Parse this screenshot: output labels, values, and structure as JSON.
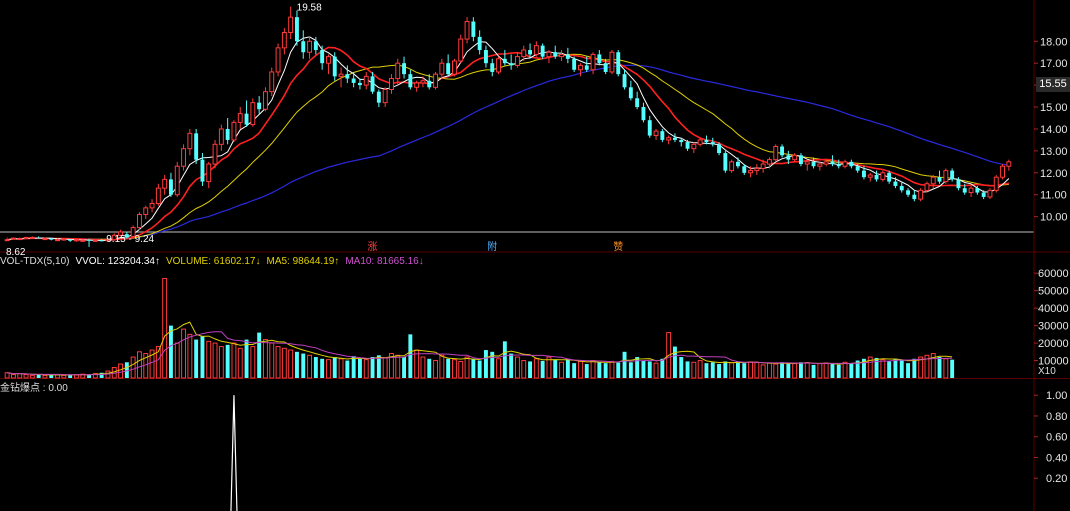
{
  "colors": {
    "up": "#ff3b3b",
    "down": "#54ffff",
    "ma_white": "#ffffff",
    "ma_red": "#ff2020",
    "ma_yellow": "#e0d000",
    "ma_blue": "#2a2ae0",
    "vol_ma5": "#e0d000",
    "vol_ma10": "#c040c0",
    "grid": "#5a0000",
    "signal": "#ffffff"
  },
  "price_panel": {
    "high_label": "19.58",
    "low_label": "8.62",
    "range_label": "9.15 - 9.24",
    "current_price": "15.55",
    "markers": [
      "涨",
      "附",
      "赞"
    ]
  },
  "volume_panel": {
    "header": {
      "indicator": "VOL-TDX(5,10)",
      "vvol": "VVOL: 123204.34↑",
      "volume": "VOLUME: 61602.17↓",
      "ma5": "MA5: 98644.19↑",
      "ma10": "MA10: 81665.16↓"
    },
    "unit_label": "X10"
  },
  "signal_panel": {
    "header": "金钻爆点 : 0.00"
  },
  "chart_data": [
    {
      "type": "candlestick",
      "title": "",
      "ylim": [
        9.3,
        19.7
      ],
      "y_ticks": [
        "18.00",
        "17.00",
        "16.00",
        "15.00",
        "14.00",
        "13.00",
        "12.00",
        "11.00",
        "10.00"
      ],
      "y_tick_values": [
        18,
        17,
        16,
        15,
        14,
        13,
        12,
        11,
        10
      ],
      "ohlc": [
        [
          8.95,
          9.05,
          9.0,
          8.95
        ],
        [
          9.0,
          9.05,
          8.98,
          9.02
        ],
        [
          9.0,
          9.05,
          8.95,
          9.0
        ],
        [
          9.0,
          9.08,
          8.97,
          9.05
        ],
        [
          9.05,
          9.1,
          9.0,
          9.05
        ],
        [
          9.05,
          9.1,
          9.0,
          9.02
        ],
        [
          9.0,
          9.05,
          8.95,
          9.0
        ],
        [
          9.0,
          9.05,
          8.92,
          8.95
        ],
        [
          8.95,
          9.0,
          8.9,
          8.95
        ],
        [
          8.95,
          9.02,
          8.9,
          8.98
        ],
        [
          8.95,
          9.0,
          8.85,
          8.9
        ],
        [
          8.9,
          8.98,
          8.85,
          8.95
        ],
        [
          8.9,
          8.97,
          8.85,
          8.92
        ],
        [
          8.95,
          9.0,
          8.62,
          8.9
        ],
        [
          8.9,
          8.95,
          8.85,
          8.92
        ],
        [
          8.92,
          8.98,
          8.87,
          8.9
        ],
        [
          8.9,
          9.0,
          8.85,
          8.95
        ],
        [
          8.95,
          9.24,
          8.9,
          9.15
        ],
        [
          9.15,
          9.4,
          9.1,
          9.3
        ],
        [
          9.2,
          9.3,
          9.0,
          9.05
        ],
        [
          9.1,
          9.6,
          9.05,
          9.5
        ],
        [
          9.5,
          10.2,
          9.4,
          10.1
        ],
        [
          10.1,
          10.5,
          9.9,
          10.4
        ],
        [
          10.4,
          10.8,
          10.2,
          10.6
        ],
        [
          10.6,
          11.5,
          10.5,
          11.3
        ],
        [
          11.3,
          11.9,
          11.0,
          11.7
        ],
        [
          11.7,
          12.0,
          10.9,
          11.0
        ],
        [
          11.0,
          12.5,
          10.9,
          12.3
        ],
        [
          12.3,
          13.3,
          12.1,
          13.1
        ],
        [
          13.1,
          14.0,
          12.8,
          13.8
        ],
        [
          13.8,
          14.0,
          12.4,
          12.6
        ],
        [
          12.6,
          12.9,
          11.4,
          11.6
        ],
        [
          11.6,
          12.5,
          11.3,
          12.4
        ],
        [
          12.4,
          13.5,
          12.2,
          13.3
        ],
        [
          13.3,
          14.2,
          13.0,
          14.0
        ],
        [
          14.0,
          14.5,
          13.3,
          13.5
        ],
        [
          13.5,
          14.4,
          13.4,
          14.3
        ],
        [
          14.3,
          15.0,
          14.0,
          14.7
        ],
        [
          14.7,
          15.3,
          14.1,
          14.2
        ],
        [
          14.2,
          15.4,
          14.1,
          15.2
        ],
        [
          15.2,
          15.5,
          14.7,
          14.9
        ],
        [
          14.9,
          15.9,
          14.8,
          15.7
        ],
        [
          15.7,
          16.8,
          15.5,
          16.6
        ],
        [
          16.6,
          17.9,
          16.4,
          17.7
        ],
        [
          17.7,
          18.6,
          17.4,
          18.4
        ],
        [
          18.4,
          19.58,
          18.1,
          19.1
        ],
        [
          19.1,
          19.4,
          17.8,
          18.0
        ],
        [
          18.0,
          18.5,
          17.2,
          17.5
        ],
        [
          17.5,
          18.2,
          17.2,
          18.0
        ],
        [
          18.0,
          18.2,
          17.4,
          17.6
        ],
        [
          17.6,
          17.8,
          16.7,
          17.0
        ],
        [
          17.0,
          17.4,
          16.5,
          17.3
        ],
        [
          17.3,
          17.5,
          16.2,
          16.4
        ],
        [
          16.4,
          16.8,
          15.9,
          16.5
        ],
        [
          16.5,
          16.9,
          16.1,
          16.3
        ],
        [
          16.3,
          16.6,
          15.9,
          16.1
        ],
        [
          16.1,
          16.3,
          15.8,
          16.0
        ],
        [
          16.0,
          16.6,
          15.8,
          16.4
        ],
        [
          16.4,
          16.6,
          15.6,
          15.7
        ],
        [
          15.7,
          15.8,
          15.0,
          15.2
        ],
        [
          15.2,
          15.9,
          15.0,
          15.8
        ],
        [
          15.8,
          16.5,
          15.6,
          16.3
        ],
        [
          16.3,
          17.2,
          16.0,
          17.0
        ],
        [
          17.0,
          17.3,
          16.3,
          16.5
        ],
        [
          16.5,
          16.7,
          15.8,
          15.9
        ],
        [
          15.9,
          16.2,
          15.7,
          16.1
        ],
        [
          16.1,
          16.4,
          15.9,
          16.2
        ],
        [
          16.2,
          16.5,
          15.8,
          15.9
        ],
        [
          15.9,
          16.6,
          15.8,
          16.5
        ],
        [
          16.5,
          17.2,
          16.3,
          17.0
        ],
        [
          17.0,
          17.4,
          16.4,
          16.5
        ],
        [
          16.5,
          17.2,
          16.4,
          17.1
        ],
        [
          17.1,
          18.3,
          17.0,
          18.1
        ],
        [
          18.1,
          19.1,
          17.9,
          18.9
        ],
        [
          18.9,
          19.1,
          18.0,
          18.2
        ],
        [
          18.2,
          18.5,
          17.4,
          17.6
        ],
        [
          17.6,
          17.8,
          16.8,
          17.0
        ],
        [
          17.0,
          17.2,
          16.4,
          16.6
        ],
        [
          16.6,
          17.3,
          16.5,
          17.2
        ],
        [
          17.2,
          17.6,
          16.9,
          17.0
        ],
        [
          17.0,
          17.4,
          16.7,
          16.9
        ],
        [
          16.9,
          17.5,
          16.8,
          17.3
        ],
        [
          17.3,
          17.8,
          17.1,
          17.6
        ],
        [
          17.6,
          17.9,
          17.2,
          17.4
        ],
        [
          17.4,
          18.0,
          17.3,
          17.8
        ],
        [
          17.8,
          17.9,
          17.2,
          17.3
        ],
        [
          17.3,
          17.6,
          17.0,
          17.5
        ],
        [
          17.5,
          17.8,
          17.2,
          17.3
        ],
        [
          17.3,
          17.6,
          17.1,
          17.4
        ],
        [
          17.4,
          17.7,
          17.0,
          17.2
        ],
        [
          17.2,
          17.3,
          16.6,
          16.7
        ],
        [
          16.7,
          17.0,
          16.4,
          16.9
        ],
        [
          16.9,
          17.3,
          16.6,
          16.7
        ],
        [
          16.7,
          17.5,
          16.5,
          17.4
        ],
        [
          17.4,
          17.6,
          16.9,
          17.0
        ],
        [
          17.0,
          17.2,
          16.5,
          16.6
        ],
        [
          16.6,
          17.6,
          16.5,
          17.5
        ],
        [
          17.5,
          17.6,
          16.4,
          16.5
        ],
        [
          16.5,
          16.7,
          15.8,
          15.9
        ],
        [
          15.9,
          16.2,
          15.3,
          15.4
        ],
        [
          15.4,
          15.7,
          14.9,
          15.0
        ],
        [
          15.0,
          15.2,
          14.3,
          14.4
        ],
        [
          14.4,
          14.6,
          13.6,
          13.7
        ],
        [
          13.7,
          14.0,
          13.5,
          13.9
        ],
        [
          13.9,
          14.0,
          13.4,
          13.5
        ],
        [
          13.5,
          13.7,
          13.3,
          13.6
        ],
        [
          13.6,
          13.8,
          13.4,
          13.5
        ],
        [
          13.5,
          13.6,
          13.2,
          13.4
        ],
        [
          13.4,
          13.5,
          13.0,
          13.1
        ],
        [
          13.1,
          13.4,
          12.9,
          13.3
        ],
        [
          13.3,
          13.6,
          13.2,
          13.5
        ],
        [
          13.5,
          13.7,
          13.3,
          13.4
        ],
        [
          13.4,
          13.6,
          13.2,
          13.3
        ],
        [
          13.3,
          13.4,
          12.8,
          12.9
        ],
        [
          12.9,
          13.0,
          12.0,
          12.1
        ],
        [
          12.1,
          12.6,
          12.0,
          12.5
        ],
        [
          12.5,
          12.7,
          12.2,
          12.3
        ],
        [
          12.3,
          12.4,
          11.9,
          12.0
        ],
        [
          12.0,
          12.3,
          11.8,
          12.1
        ],
        [
          12.1,
          12.4,
          11.9,
          12.2
        ],
        [
          12.2,
          12.6,
          12.0,
          12.4
        ],
        [
          12.4,
          12.7,
          12.2,
          12.6
        ],
        [
          12.6,
          13.3,
          12.5,
          13.2
        ],
        [
          13.2,
          13.3,
          12.7,
          12.8
        ],
        [
          12.8,
          13.0,
          12.4,
          12.6
        ],
        [
          12.6,
          12.9,
          12.5,
          12.8
        ],
        [
          12.8,
          12.9,
          12.3,
          12.4
        ],
        [
          12.4,
          12.6,
          12.1,
          12.5
        ],
        [
          12.5,
          12.7,
          12.2,
          12.3
        ],
        [
          12.3,
          12.5,
          12.1,
          12.4
        ],
        [
          12.4,
          12.6,
          12.3,
          12.5
        ],
        [
          12.5,
          12.8,
          12.3,
          12.4
        ],
        [
          12.4,
          12.6,
          12.2,
          12.3
        ],
        [
          12.3,
          12.6,
          12.2,
          12.5
        ],
        [
          12.5,
          12.6,
          12.2,
          12.3
        ],
        [
          12.3,
          12.4,
          12.0,
          12.1
        ],
        [
          12.1,
          12.3,
          11.7,
          11.8
        ],
        [
          11.8,
          12.0,
          11.6,
          11.9
        ],
        [
          11.9,
          12.1,
          11.6,
          11.7
        ],
        [
          11.7,
          12.1,
          11.6,
          12.0
        ],
        [
          12.0,
          12.1,
          11.5,
          11.6
        ],
        [
          11.6,
          11.8,
          11.3,
          11.4
        ],
        [
          11.4,
          11.6,
          11.1,
          11.2
        ],
        [
          11.2,
          11.3,
          10.9,
          11.0
        ],
        [
          11.0,
          11.2,
          10.7,
          10.8
        ],
        [
          10.8,
          11.3,
          10.7,
          11.2
        ],
        [
          11.2,
          11.6,
          11.1,
          11.5
        ],
        [
          11.5,
          11.9,
          11.3,
          11.8
        ],
        [
          11.8,
          12.1,
          11.5,
          11.6
        ],
        [
          11.6,
          12.2,
          11.5,
          12.1
        ],
        [
          12.1,
          12.2,
          11.6,
          11.7
        ],
        [
          11.7,
          11.8,
          11.2,
          11.3
        ],
        [
          11.3,
          11.5,
          11.0,
          11.1
        ],
        [
          11.1,
          11.4,
          10.9,
          11.3
        ],
        [
          11.3,
          11.4,
          11.0,
          11.1
        ],
        [
          11.1,
          11.2,
          10.8,
          10.9
        ],
        [
          10.9,
          11.3,
          10.8,
          11.2
        ],
        [
          11.2,
          11.9,
          11.1,
          11.8
        ],
        [
          11.8,
          12.4,
          11.7,
          12.3
        ],
        [
          12.3,
          12.6,
          12.1,
          12.5
        ]
      ],
      "volume": [
        3000,
        2000,
        2500,
        2000,
        1500,
        2000,
        1500,
        2000,
        1800,
        1500,
        2000,
        1800,
        2200,
        2000,
        2500,
        3000,
        4000,
        6000,
        8000,
        9000,
        12000,
        15000,
        14000,
        16000,
        18000,
        57000,
        30000,
        20000,
        28000,
        25000,
        22000,
        24000,
        21000,
        20000,
        18000,
        19000,
        20000,
        17000,
        22000,
        18000,
        26000,
        22000,
        20000,
        18000,
        17000,
        16000,
        15000,
        14000,
        13000,
        12000,
        11000,
        10500,
        12000,
        11000,
        10000,
        12500,
        11000,
        10500,
        12000,
        13000,
        11500,
        14000,
        13000,
        12000,
        25000,
        16000,
        12000,
        11000,
        10000,
        13000,
        11000,
        10500,
        9500,
        12000,
        11000,
        10000,
        16000,
        15000,
        11000,
        21000,
        14000,
        12000,
        10000,
        9500,
        11000,
        9800,
        12000,
        10500,
        9000,
        11000,
        8500,
        9500,
        8000,
        10000,
        9000,
        8500,
        9500,
        8800,
        15000,
        9000,
        12000,
        10000,
        9500,
        8500,
        11000,
        26000,
        18000,
        12000,
        9500,
        9000,
        10000,
        8500,
        9000,
        8000,
        9500,
        8800,
        9500,
        8500,
        9200,
        9000,
        7500,
        8500,
        8000,
        9000,
        8600,
        8200,
        9000,
        8800,
        7500,
        8200,
        8600,
        8000,
        7600,
        9000,
        8500,
        10000,
        11000,
        12000,
        11500,
        10500,
        9500,
        11000,
        10000,
        8500,
        11000,
        12000,
        13000,
        14000,
        12000,
        11000,
        10500
      ],
      "vol_ylim": [
        0,
        63000
      ],
      "vol_y_ticks": [
        "60000",
        "50000",
        "40000",
        "30000",
        "20000",
        "10000"
      ],
      "vol_y_tick_values": [
        60000,
        50000,
        40000,
        30000,
        20000,
        10000
      ],
      "signal": {
        "spike_index": 36,
        "spike_value": 1.0,
        "ylim": [
          0,
          1.05
        ],
        "y_ticks": [
          "1.00",
          "0.80",
          "0.60",
          "0.40",
          "0.20"
        ],
        "y_tick_values": [
          1.0,
          0.8,
          0.6,
          0.4,
          0.2
        ]
      }
    }
  ]
}
